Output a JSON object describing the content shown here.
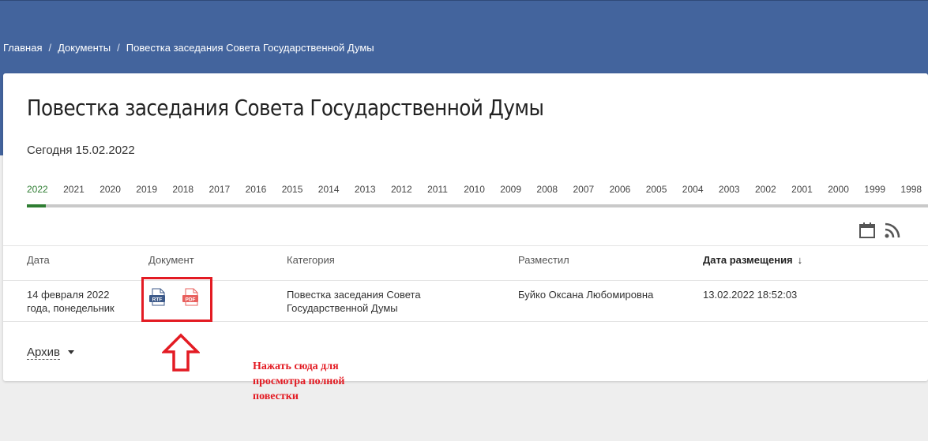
{
  "breadcrumb": {
    "home": "Главная",
    "documents": "Документы",
    "current": "Повестка заседания Совета Государственной Думы"
  },
  "page": {
    "title": "Повестка заседания Совета Государственной Думы",
    "today": "Сегодня 15.02.2022"
  },
  "years": [
    "2022",
    "2021",
    "2020",
    "2019",
    "2018",
    "2017",
    "2016",
    "2015",
    "2014",
    "2013",
    "2012",
    "2011",
    "2010",
    "2009",
    "2008",
    "2007",
    "2006",
    "2005",
    "2004",
    "2003",
    "2002",
    "2001",
    "2000",
    "1999",
    "1998"
  ],
  "active_year": "2022",
  "table": {
    "headers": {
      "date": "Дата",
      "document": "Документ",
      "category": "Категория",
      "author": "Разместил",
      "posted": "Дата размещения",
      "sort_arrow": "↓"
    },
    "rows": [
      {
        "date": "14 февраля 2022 года, понедельник",
        "rtf_label": "RTF",
        "pdf_label": "PDF",
        "category": "Повестка заседания Совета Государственной Думы",
        "author": "Буйко Оксана Любомировна",
        "posted": "13.02.2022 18:52:03"
      }
    ]
  },
  "archive": {
    "label": "Архив"
  },
  "annotation": {
    "text": "Нажать сюда для просмотра полной повестки"
  },
  "colors": {
    "header_bg": "#43649d",
    "active_year": "#2e7d32",
    "annotation": "#e31b23",
    "rtf_icon": "#3d5a8a",
    "pdf_icon": "#e8605e"
  },
  "icons": {
    "calendar": "calendar-icon",
    "rss": "rss-icon"
  }
}
